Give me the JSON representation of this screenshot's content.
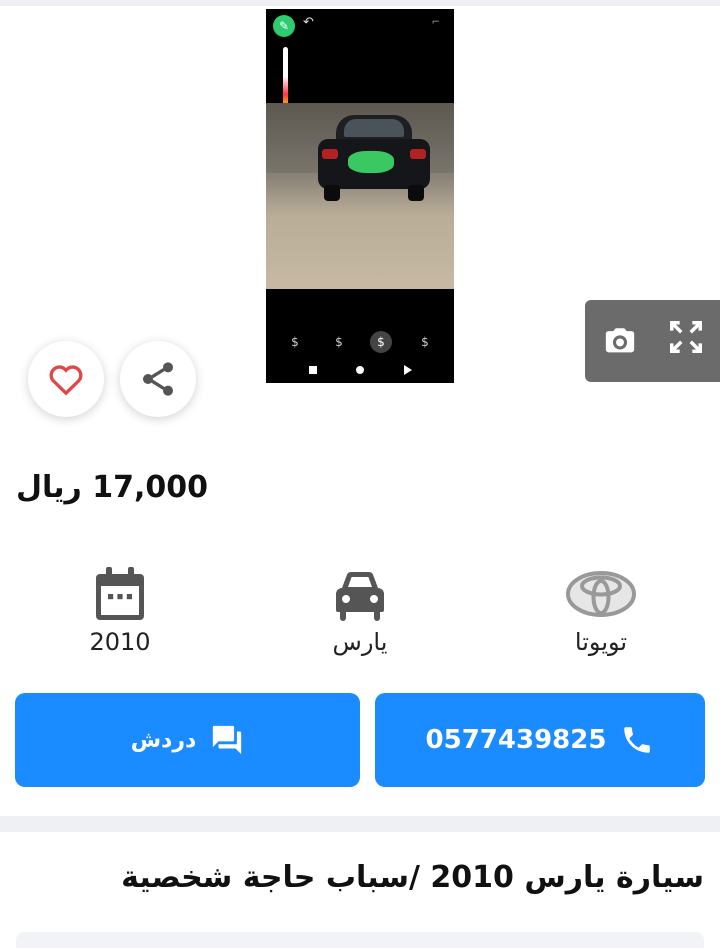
{
  "listing": {
    "price": "17,000 ريال",
    "title": "سيارة يارس 2010 /سباب حاجة شخصية"
  },
  "specs": {
    "year": "2010",
    "model": "يارس",
    "brand": "تويوتا"
  },
  "actions": {
    "call_label": "0577439825",
    "chat_label": "دردش"
  },
  "colors": {
    "accent": "#1a8cff",
    "favorite": "#e04848",
    "gallery_overlay": "#6b6b6b"
  },
  "icons": {
    "favorite": "heart-icon",
    "share": "share-icon",
    "camera": "camera-icon",
    "fullscreen": "expand-icon",
    "year": "calendar-icon",
    "model": "car-icon",
    "brand": "toyota-logo",
    "call": "phone-icon",
    "chat": "chat-icon"
  }
}
